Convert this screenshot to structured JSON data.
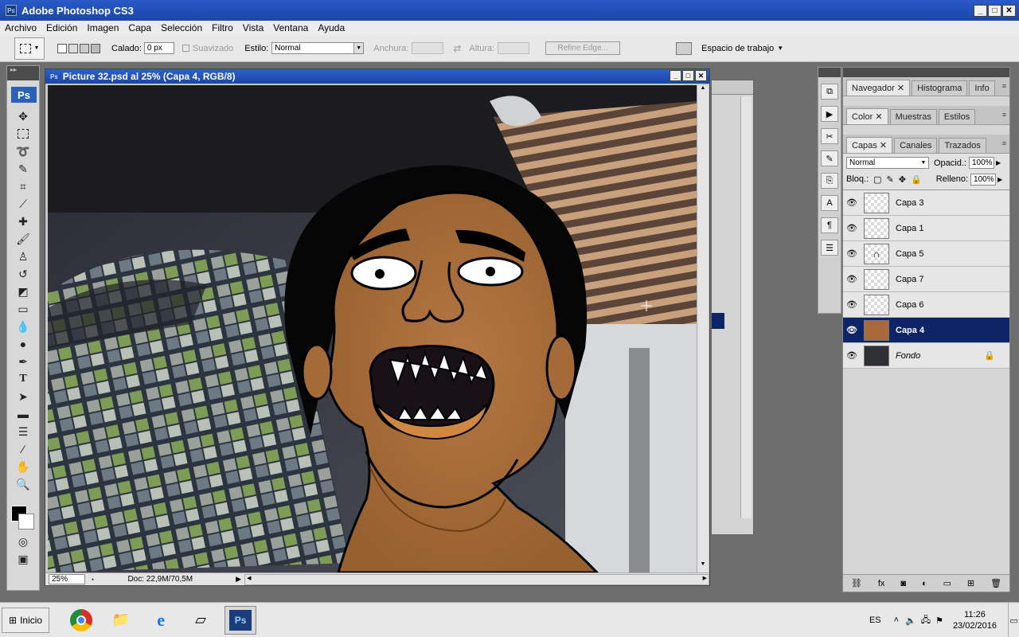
{
  "app": {
    "title": "Adobe Photoshop CS3"
  },
  "window_buttons": {
    "minimize": "_",
    "maximize": "□",
    "close": "✕"
  },
  "menu": [
    "Archivo",
    "Edición",
    "Imagen",
    "Capa",
    "Selección",
    "Filtro",
    "Vista",
    "Ventana",
    "Ayuda"
  ],
  "options": {
    "feather_label": "Calado:",
    "feather_value": "0 px",
    "antialias_label": "Suavizado",
    "style_label": "Estilo:",
    "style_value": "Normal",
    "width_label": "Anchura:",
    "height_label": "Altura:",
    "refine_label": "Refine Edge...",
    "workspace_label": "Espacio de trabajo"
  },
  "toolbox": {
    "logo": "Ps"
  },
  "document": {
    "title": "Picture 32.psd al 25% (Capa 4, RGB/8)",
    "zoom": "25%",
    "doc_size": "Doc: 22,9M/70,5M"
  },
  "panels": {
    "group1_tabs": [
      "Navegador",
      "Histograma",
      "Info"
    ],
    "group2_tabs": [
      "Color",
      "Muestras",
      "Estilos"
    ],
    "group3_tabs": [
      "Capas",
      "Canales",
      "Trazados"
    ],
    "blend_mode": "Normal",
    "opacity_label": "Opacid.:",
    "opacity_value": "100%",
    "lock_label": "Bloq.:",
    "fill_label": "Relleno:",
    "fill_value": "100%",
    "layers": [
      {
        "name": "Capa 3",
        "selected": false
      },
      {
        "name": "Capa 1",
        "selected": false
      },
      {
        "name": "Capa 5",
        "selected": false
      },
      {
        "name": "Capa 7",
        "selected": false
      },
      {
        "name": "Capa 6",
        "selected": false
      },
      {
        "name": "Capa 4",
        "selected": true
      },
      {
        "name": "Fondo",
        "selected": false,
        "locked": true
      }
    ]
  },
  "taskbar": {
    "start_label": "Inicio",
    "language": "ES",
    "time": "11:26",
    "date": "23/02/2016"
  },
  "colors": {
    "title_blue": "#2150b8",
    "selected_layer": "#0d2466",
    "skin": "#a86a3a"
  }
}
